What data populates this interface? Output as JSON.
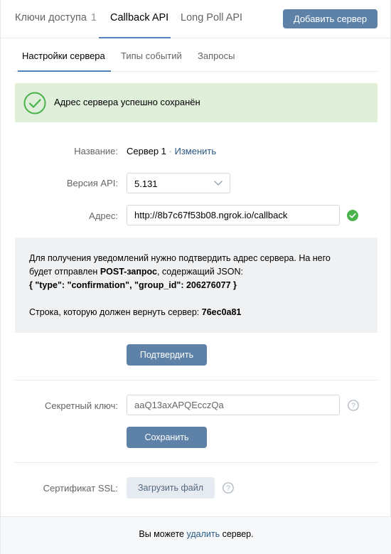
{
  "top_tabs": {
    "keys_label": "Ключи доступа",
    "keys_count": "1",
    "callback_label": "Callback API",
    "longpoll_label": "Long Poll API",
    "add_server_label": "Добавить сервер"
  },
  "sub_tabs": {
    "server_settings": "Настройки сервера",
    "event_types": "Типы событий",
    "requests": "Запросы"
  },
  "success": {
    "message": "Адрес сервера успешно сохранён",
    "icon": "check-circle-icon",
    "background": "#e0efd9"
  },
  "form": {
    "name_label": "Название:",
    "name_value": "Сервер 1",
    "name_sep": " · ",
    "name_edit_link": "Изменить",
    "api_label": "Версия API:",
    "api_value": "5.131",
    "address_label": "Адрес:",
    "address_value": "http://8b7c67f53b08.ngrok.io/callback",
    "address_status_icon": "check-green-icon"
  },
  "info": {
    "line1": "Для получения уведомлений нужно подтвердить адрес сервера. На него",
    "line2_prefix": "будет отправлен ",
    "line2_bold": "POST-запрос",
    "line2_suffix": ", содержащий JSON:",
    "line3": "{ \"type\": \"confirmation\", \"group_id\": 206276077 }",
    "line4_prefix": "Строка, которую должен вернуть сервер: ",
    "line4_bold": "76ec0a81"
  },
  "confirm_button": "Подтвердить",
  "secret": {
    "label": "Секретный ключ:",
    "value": "aaQ13axAPQEcczQa",
    "save_button": "Сохранить"
  },
  "ssl": {
    "label": "Сертификат SSL:",
    "upload_button": "Загрузить файл"
  },
  "footer": {
    "prefix": "Вы можете ",
    "link": "удалить",
    "suffix": " сервер."
  },
  "colors": {
    "accent": "#5181b8",
    "button": "#5e81a8",
    "link": "#2a5885",
    "success_green": "#4bb34b"
  }
}
